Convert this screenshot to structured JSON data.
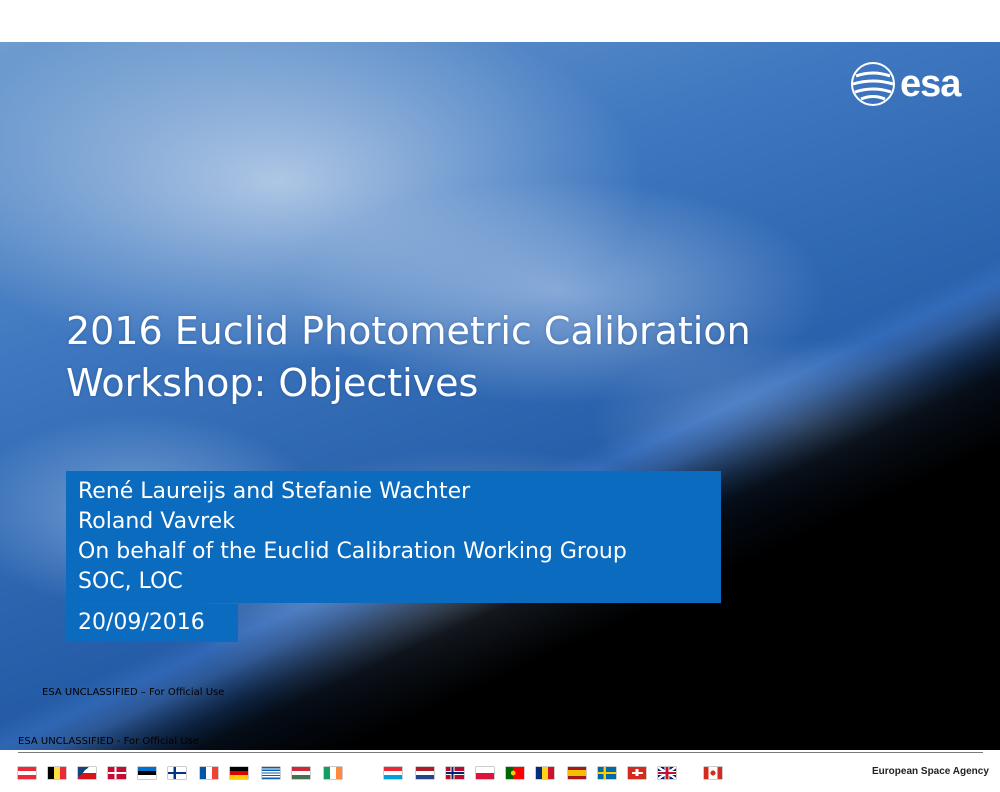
{
  "slide": {
    "title_lines": [
      "2016 Euclid Photometric Calibration",
      "Workshop: Objectives"
    ],
    "authors": [
      "René Laureijs and Stefanie Wachter",
      "Roland Vavrek",
      "On behalf of the Euclid Calibration Working Group",
      "SOC, LOC"
    ],
    "date": "20/09/2016",
    "inner_classification": "ESA UNCLASSIFIED  – For Official Use",
    "logo_text": "esa"
  },
  "footer": {
    "classification": "ESA UNCLASSIFIED  - For Official Use",
    "agency": "European Space Agency",
    "flags": [
      {
        "country": "austria"
      },
      {
        "country": "belgium"
      },
      {
        "country": "czech-republic"
      },
      {
        "country": "denmark"
      },
      {
        "country": "estonia"
      },
      {
        "country": "finland"
      },
      {
        "country": "france"
      },
      {
        "country": "germany"
      },
      {
        "country": "greece"
      },
      {
        "country": "hungary"
      },
      {
        "country": "ireland"
      },
      {
        "country": "luxembourg"
      },
      {
        "country": "netherlands"
      },
      {
        "country": "norway"
      },
      {
        "country": "poland"
      },
      {
        "country": "portugal"
      },
      {
        "country": "romania"
      },
      {
        "country": "spain"
      },
      {
        "country": "sweden"
      },
      {
        "country": "switzerland"
      },
      {
        "country": "united-kingdom"
      },
      {
        "country": "canada"
      }
    ]
  },
  "colors": {
    "accent_box": "#0a6bbf",
    "title_text": "#ffffff"
  }
}
